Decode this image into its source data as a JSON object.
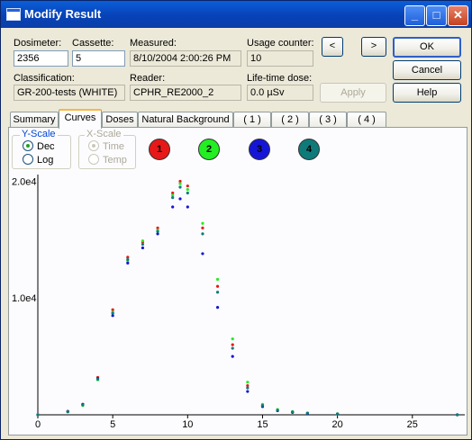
{
  "window": {
    "title": "Modify Result"
  },
  "titlebar": {
    "minimize": "_",
    "maximize": "□",
    "close": "✕"
  },
  "fields": {
    "dosimeter_label": "Dosimeter:",
    "dosimeter_value": "2356",
    "cassette_label": "Cassette:",
    "cassette_value": "5",
    "measured_label": "Measured:",
    "measured_value": "8/10/2004 2:00:26 PM",
    "usage_label": "Usage counter:",
    "usage_value": "10",
    "classification_label": "Classification:",
    "classification_value": "GR-200-tests (WHITE)",
    "reader_label": "Reader:",
    "reader_value": "CPHR_RE2000_2",
    "lifetime_label": "Life-time dose:",
    "lifetime_value": "0.0 µSv"
  },
  "nav": {
    "prev": "<",
    "next": ">"
  },
  "buttons": {
    "ok": "OK",
    "cancel": "Cancel",
    "help": "Help",
    "apply": "Apply"
  },
  "tabs": [
    "Summary",
    "Curves",
    "Doses",
    "Natural Background",
    "( 1 )",
    "( 2 )",
    "( 3 )",
    "( 4 )"
  ],
  "active_tab": "Curves",
  "yscale": {
    "title": "Y-Scale",
    "options": [
      "Dec",
      "Log"
    ],
    "selected": "Dec"
  },
  "xscale": {
    "title": "X-Scale",
    "options": [
      "Time",
      "Temp"
    ],
    "selected": "Time"
  },
  "curve_buttons": [
    {
      "label": "1",
      "color": "#e81818"
    },
    {
      "label": "2",
      "color": "#22ee22"
    },
    {
      "label": "3",
      "color": "#1515d8"
    },
    {
      "label": "4",
      "color": "#0f7a7a"
    }
  ],
  "chart_data": {
    "type": "scatter",
    "x_ticks": [
      "0",
      "5",
      "10",
      "15",
      "20",
      "25"
    ],
    "y_ticks": [
      "1.0e4",
      "2.0e4"
    ],
    "xlim": [
      0,
      28.5
    ],
    "ylim": [
      0,
      20500
    ],
    "grid": false,
    "series": [
      {
        "color": "#e81818",
        "x": [
          0,
          2,
          3,
          4,
          5,
          6,
          7,
          8,
          9,
          9.5,
          10,
          11,
          12,
          13,
          14,
          15,
          16,
          17,
          18,
          20,
          28
        ],
        "y": [
          0,
          300,
          900,
          3200,
          9000,
          13500,
          14800,
          16000,
          19000,
          20000,
          19600,
          16000,
          11000,
          6000,
          2500,
          800,
          400,
          250,
          150,
          80,
          0
        ]
      },
      {
        "color": "#22ee22",
        "x": [
          0,
          2,
          3,
          4,
          5,
          6,
          7,
          8,
          9,
          9.5,
          10,
          11,
          12,
          13,
          14,
          15,
          16,
          17,
          18,
          20,
          28
        ],
        "y": [
          0,
          250,
          800,
          3000,
          8800,
          13200,
          14900,
          15800,
          18800,
          19800,
          19300,
          16400,
          11600,
          6500,
          2800,
          900,
          450,
          280,
          160,
          90,
          0
        ]
      },
      {
        "color": "#1515d8",
        "x": [
          0,
          2,
          3,
          4,
          5,
          6,
          7,
          8,
          9,
          9.5,
          10,
          11,
          12,
          13,
          14,
          15,
          16,
          17,
          18,
          20,
          28
        ],
        "y": [
          0,
          280,
          900,
          3100,
          8500,
          13000,
          14300,
          15500,
          17800,
          18500,
          17800,
          13800,
          9200,
          5000,
          2000,
          700,
          350,
          200,
          120,
          60,
          0
        ]
      },
      {
        "color": "#0f7a7a",
        "x": [
          0,
          2,
          3,
          4,
          5,
          6,
          7,
          8,
          9,
          9.5,
          10,
          11,
          12,
          13,
          14,
          15,
          16,
          17,
          18,
          20,
          28
        ],
        "y": [
          0,
          260,
          850,
          3050,
          8700,
          13300,
          14600,
          15700,
          18600,
          19500,
          19000,
          15500,
          10500,
          5700,
          2300,
          800,
          400,
          240,
          140,
          70,
          0
        ]
      }
    ]
  }
}
